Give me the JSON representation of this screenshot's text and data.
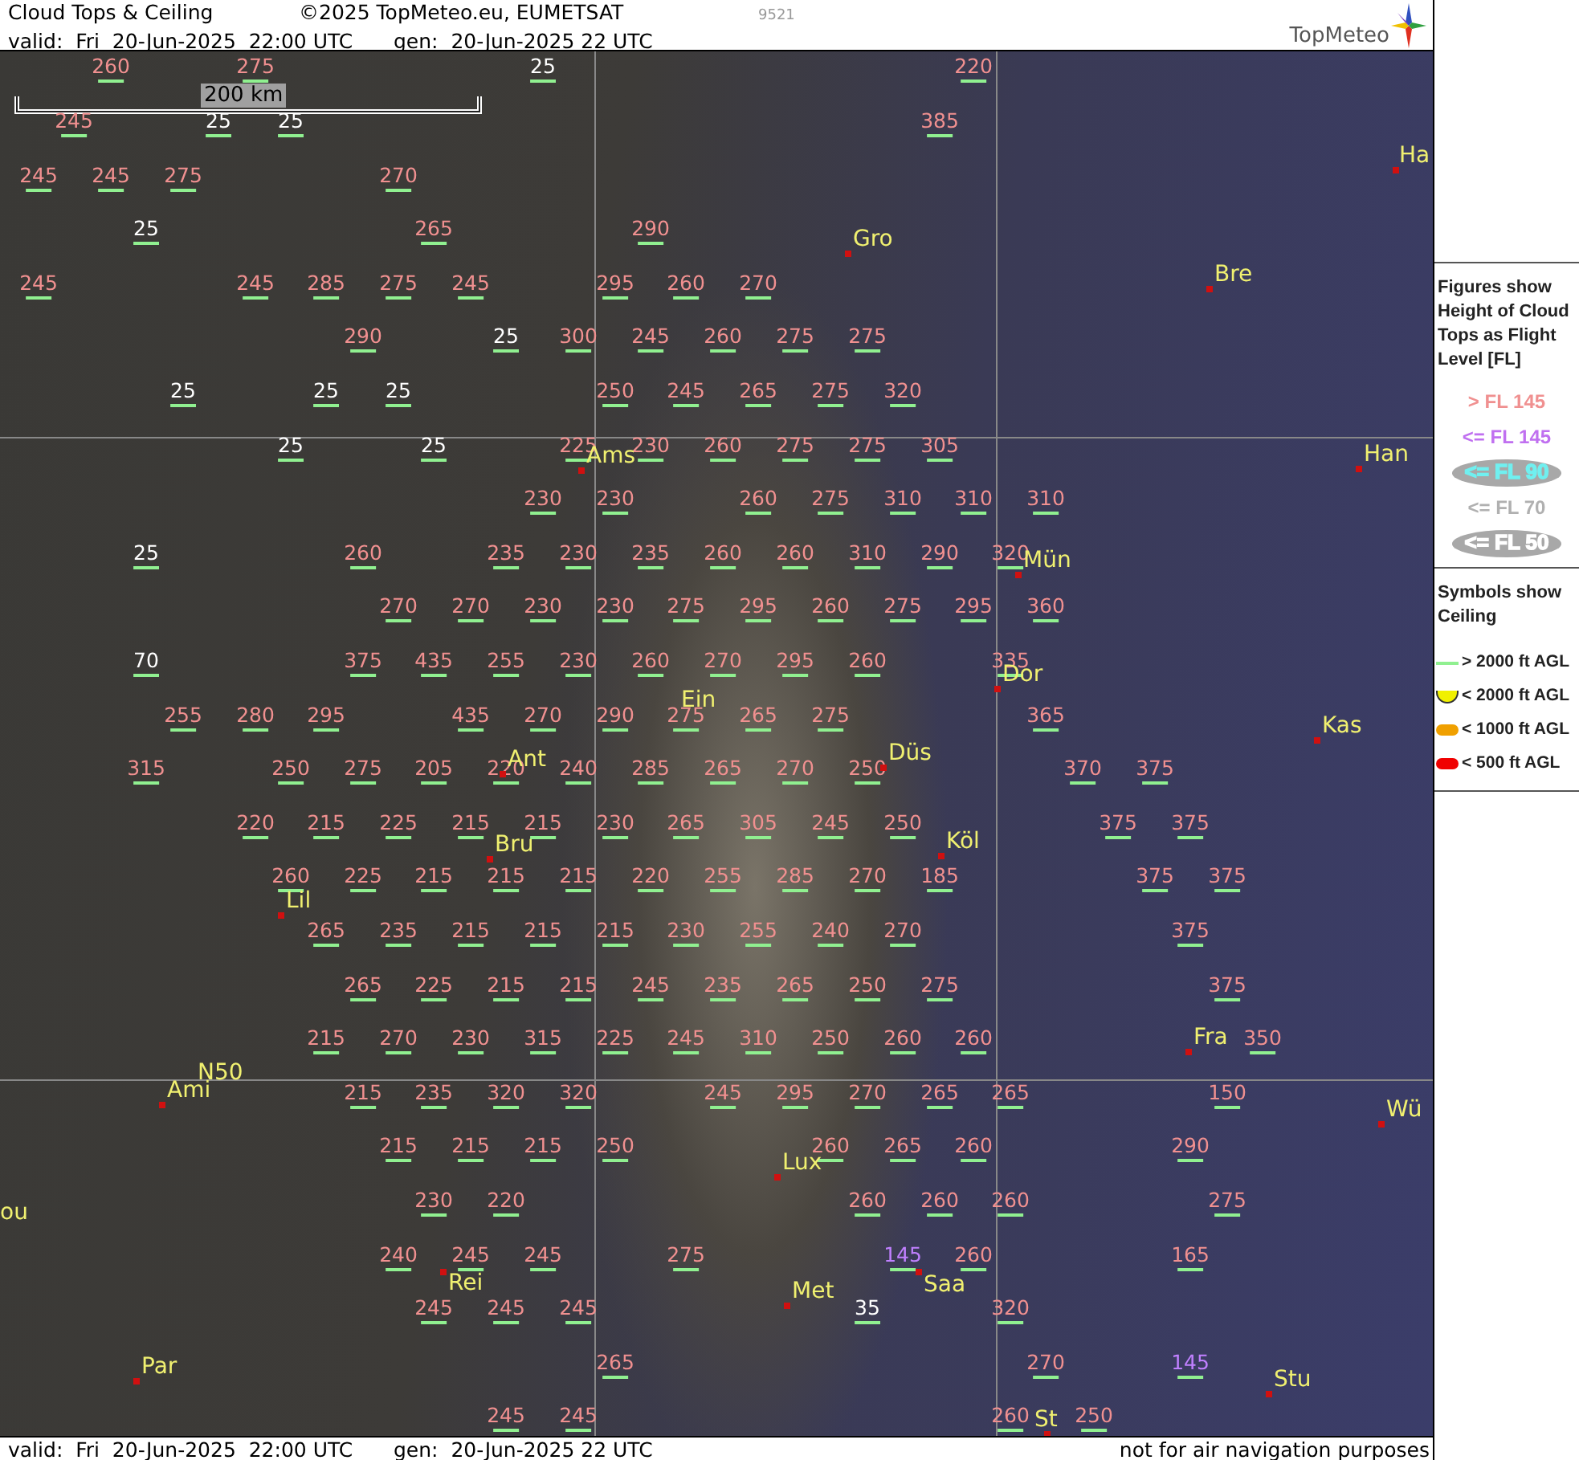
{
  "header": {
    "title": "Cloud Tops & Ceiling",
    "copyright": "©2025 TopMeteo.eu, EUMETSAT",
    "code": "9521",
    "valid": "valid:  Fri  20-Jun-2025  22:00 UTC",
    "generated": "gen:  20-Jun-2025 22 UTC",
    "logo": "TopMeteo"
  },
  "map": {
    "scale_bar": "200 km",
    "cloud_tops": [
      [
        {
          "value": "260",
          "color": "#f09090"
        },
        {
          "value": "275",
          "color": "#f09090"
        },
        {
          "value": "25",
          "color": "#ffffff"
        },
        {
          "value": "220",
          "color": "#f09090"
        }
      ],
      [
        {
          "value": "245",
          "color": "#f09090"
        },
        {
          "value": "25",
          "color": "#ffffff"
        },
        {
          "value": "25",
          "color": "#ffffff"
        },
        {
          "value": "385",
          "color": "#f09090"
        }
      ],
      [
        {
          "value": "245",
          "color": "#f09090"
        },
        {
          "value": "245",
          "color": "#f09090"
        },
        {
          "value": "275",
          "color": "#f09090"
        },
        {
          "value": "270",
          "color": "#f09090"
        }
      ],
      [
        {
          "value": "25",
          "color": "#ffffff"
        },
        {
          "value": "265",
          "color": "#f09090"
        },
        {
          "value": "290",
          "color": "#f09090"
        }
      ],
      [
        {
          "value": "245",
          "color": "#f09090"
        },
        {
          "value": "245",
          "color": "#f09090"
        },
        {
          "value": "285",
          "color": "#f09090"
        },
        {
          "value": "275",
          "color": "#f09090"
        },
        {
          "value": "245",
          "color": "#f09090"
        },
        {
          "value": "295",
          "color": "#f09090"
        },
        {
          "value": "260",
          "color": "#f09090"
        },
        {
          "value": "270",
          "color": "#f09090"
        }
      ],
      [
        {
          "value": "290",
          "color": "#f09090"
        },
        {
          "value": "25",
          "color": "#ffffff"
        },
        {
          "value": "300",
          "color": "#f09090"
        },
        {
          "value": "245",
          "color": "#f09090"
        },
        {
          "value": "260",
          "color": "#f09090"
        },
        {
          "value": "275",
          "color": "#f09090"
        },
        {
          "value": "275",
          "color": "#f09090"
        }
      ],
      [
        {
          "value": "25",
          "color": "#ffffff"
        },
        {
          "value": "25",
          "color": "#ffffff"
        },
        {
          "value": "25",
          "color": "#ffffff"
        },
        {
          "value": "250",
          "color": "#f09090"
        },
        {
          "value": "245",
          "color": "#f09090"
        },
        {
          "value": "265",
          "color": "#f09090"
        },
        {
          "value": "275",
          "color": "#f09090"
        },
        {
          "value": "320",
          "color": "#f09090"
        }
      ],
      [
        {
          "value": "25",
          "color": "#ffffff"
        },
        {
          "value": "25",
          "color": "#ffffff"
        },
        {
          "value": "225",
          "color": "#f09090"
        },
        {
          "value": "230",
          "color": "#f09090"
        },
        {
          "value": "260",
          "color": "#f09090"
        },
        {
          "value": "275",
          "color": "#f09090"
        },
        {
          "value": "275",
          "color": "#f09090"
        },
        {
          "value": "305",
          "color": "#f09090"
        }
      ],
      [
        {
          "value": "230",
          "color": "#f09090"
        },
        {
          "value": "230",
          "color": "#f09090"
        },
        {
          "value": "260",
          "color": "#f09090"
        },
        {
          "value": "275",
          "color": "#f09090"
        },
        {
          "value": "310",
          "color": "#f09090"
        },
        {
          "value": "310",
          "color": "#f09090"
        },
        {
          "value": "310",
          "color": "#f09090"
        }
      ],
      [
        {
          "value": "25",
          "color": "#ffffff"
        },
        {
          "value": "260",
          "color": "#f09090"
        },
        {
          "value": "235",
          "color": "#f09090"
        },
        {
          "value": "230",
          "color": "#f09090"
        },
        {
          "value": "235",
          "color": "#f09090"
        },
        {
          "value": "260",
          "color": "#f09090"
        },
        {
          "value": "260",
          "color": "#f09090"
        },
        {
          "value": "310",
          "color": "#f09090"
        },
        {
          "value": "290",
          "color": "#f09090"
        },
        {
          "value": "320",
          "color": "#f09090"
        }
      ],
      [
        {
          "value": "270",
          "color": "#f09090"
        },
        {
          "value": "270",
          "color": "#f09090"
        },
        {
          "value": "230",
          "color": "#f09090"
        },
        {
          "value": "230",
          "color": "#f09090"
        },
        {
          "value": "275",
          "color": "#f09090"
        },
        {
          "value": "295",
          "color": "#f09090"
        },
        {
          "value": "260",
          "color": "#f09090"
        },
        {
          "value": "275",
          "color": "#f09090"
        },
        {
          "value": "295",
          "color": "#f09090"
        },
        {
          "value": "360",
          "color": "#f09090"
        }
      ],
      [
        {
          "value": "70",
          "color": "#ffffff"
        },
        {
          "value": "375",
          "color": "#f09090"
        },
        {
          "value": "435",
          "color": "#f09090"
        },
        {
          "value": "255",
          "color": "#f09090"
        },
        {
          "value": "230",
          "color": "#f09090"
        },
        {
          "value": "260",
          "color": "#f09090"
        },
        {
          "value": "270",
          "color": "#f09090"
        },
        {
          "value": "295",
          "color": "#f09090"
        },
        {
          "value": "260",
          "color": "#f09090"
        },
        {
          "value": "335",
          "color": "#f09090"
        }
      ],
      [
        {
          "value": "255",
          "color": "#f09090"
        },
        {
          "value": "280",
          "color": "#f09090"
        },
        {
          "value": "295",
          "color": "#f09090"
        },
        {
          "value": "435",
          "color": "#f09090"
        },
        {
          "value": "270",
          "color": "#f09090"
        },
        {
          "value": "290",
          "color": "#f09090"
        },
        {
          "value": "275",
          "color": "#f09090"
        },
        {
          "value": "265",
          "color": "#f09090"
        },
        {
          "value": "275",
          "color": "#f09090"
        },
        {
          "value": "365",
          "color": "#f09090"
        }
      ],
      [
        {
          "value": "315",
          "color": "#f09090"
        },
        {
          "value": "250",
          "color": "#f09090"
        },
        {
          "value": "275",
          "color": "#f09090"
        },
        {
          "value": "205",
          "color": "#f09090"
        },
        {
          "value": "220",
          "color": "#f09090"
        },
        {
          "value": "240",
          "color": "#f09090"
        },
        {
          "value": "285",
          "color": "#f09090"
        },
        {
          "value": "265",
          "color": "#f09090"
        },
        {
          "value": "270",
          "color": "#f09090"
        },
        {
          "value": "250",
          "color": "#f09090"
        },
        {
          "value": "370",
          "color": "#f09090"
        },
        {
          "value": "375",
          "color": "#f09090"
        }
      ],
      [
        {
          "value": "220",
          "color": "#f09090"
        },
        {
          "value": "215",
          "color": "#f09090"
        },
        {
          "value": "225",
          "color": "#f09090"
        },
        {
          "value": "215",
          "color": "#f09090"
        },
        {
          "value": "215",
          "color": "#f09090"
        },
        {
          "value": "230",
          "color": "#f09090"
        },
        {
          "value": "265",
          "color": "#f09090"
        },
        {
          "value": "305",
          "color": "#f09090"
        },
        {
          "value": "245",
          "color": "#f09090"
        },
        {
          "value": "250",
          "color": "#f09090"
        },
        {
          "value": "375",
          "color": "#f09090"
        },
        {
          "value": "375",
          "color": "#f09090"
        }
      ],
      [
        {
          "value": "260",
          "color": "#f09090"
        },
        {
          "value": "225",
          "color": "#f09090"
        },
        {
          "value": "215",
          "color": "#f09090"
        },
        {
          "value": "215",
          "color": "#f09090"
        },
        {
          "value": "215",
          "color": "#f09090"
        },
        {
          "value": "220",
          "color": "#f09090"
        },
        {
          "value": "255",
          "color": "#f09090"
        },
        {
          "value": "285",
          "color": "#f09090"
        },
        {
          "value": "270",
          "color": "#f09090"
        },
        {
          "value": "185",
          "color": "#f09090"
        },
        {
          "value": "375",
          "color": "#f09090"
        },
        {
          "value": "375",
          "color": "#f09090"
        }
      ],
      [
        {
          "value": "265",
          "color": "#f09090"
        },
        {
          "value": "235",
          "color": "#f09090"
        },
        {
          "value": "215",
          "color": "#f09090"
        },
        {
          "value": "215",
          "color": "#f09090"
        },
        {
          "value": "215",
          "color": "#f09090"
        },
        {
          "value": "230",
          "color": "#f09090"
        },
        {
          "value": "255",
          "color": "#f09090"
        },
        {
          "value": "240",
          "color": "#f09090"
        },
        {
          "value": "270",
          "color": "#f09090"
        },
        {
          "value": "375",
          "color": "#f09090"
        }
      ],
      [
        {
          "value": "265",
          "color": "#f09090"
        },
        {
          "value": "225",
          "color": "#f09090"
        },
        {
          "value": "215",
          "color": "#f09090"
        },
        {
          "value": "215",
          "color": "#f09090"
        },
        {
          "value": "245",
          "color": "#f09090"
        },
        {
          "value": "235",
          "color": "#f09090"
        },
        {
          "value": "265",
          "color": "#f09090"
        },
        {
          "value": "250",
          "color": "#f09090"
        },
        {
          "value": "275",
          "color": "#f09090"
        },
        {
          "value": "375",
          "color": "#f09090"
        }
      ],
      [
        {
          "value": "215",
          "color": "#f09090"
        },
        {
          "value": "270",
          "color": "#f09090"
        },
        {
          "value": "230",
          "color": "#f09090"
        },
        {
          "value": "315",
          "color": "#f09090"
        },
        {
          "value": "225",
          "color": "#f09090"
        },
        {
          "value": "245",
          "color": "#f09090"
        },
        {
          "value": "310",
          "color": "#f09090"
        },
        {
          "value": "250",
          "color": "#f09090"
        },
        {
          "value": "260",
          "color": "#f09090"
        },
        {
          "value": "260",
          "color": "#f09090"
        },
        {
          "value": "350",
          "color": "#f09090"
        }
      ],
      [
        {
          "value": "215",
          "color": "#f09090"
        },
        {
          "value": "235",
          "color": "#f09090"
        },
        {
          "value": "320",
          "color": "#f09090"
        },
        {
          "value": "320",
          "color": "#f09090"
        },
        {
          "value": "245",
          "color": "#f09090"
        },
        {
          "value": "295",
          "color": "#f09090"
        },
        {
          "value": "270",
          "color": "#f09090"
        },
        {
          "value": "265",
          "color": "#f09090"
        },
        {
          "value": "265",
          "color": "#f09090"
        },
        {
          "value": "150",
          "color": "#f09090"
        }
      ],
      [
        {
          "value": "215",
          "color": "#f09090"
        },
        {
          "value": "215",
          "color": "#f09090"
        },
        {
          "value": "215",
          "color": "#f09090"
        },
        {
          "value": "250",
          "color": "#f09090"
        },
        {
          "value": "260",
          "color": "#f09090"
        },
        {
          "value": "265",
          "color": "#f09090"
        },
        {
          "value": "260",
          "color": "#f09090"
        },
        {
          "value": "290",
          "color": "#f09090"
        }
      ],
      [
        {
          "value": "230",
          "color": "#f09090"
        },
        {
          "value": "220",
          "color": "#f09090"
        },
        {
          "value": "260",
          "color": "#f09090"
        },
        {
          "value": "260",
          "color": "#f09090"
        },
        {
          "value": "260",
          "color": "#f09090"
        },
        {
          "value": "275",
          "color": "#f09090"
        }
      ],
      [
        {
          "value": "240",
          "color": "#f09090"
        },
        {
          "value": "245",
          "color": "#f09090"
        },
        {
          "value": "245",
          "color": "#f09090"
        },
        {
          "value": "275",
          "color": "#f09090"
        },
        {
          "value": "145",
          "color": "#c080ff"
        },
        {
          "value": "260",
          "color": "#f09090"
        },
        {
          "value": "165",
          "color": "#f09090"
        }
      ],
      [
        {
          "value": "245",
          "color": "#f09090"
        },
        {
          "value": "245",
          "color": "#f09090"
        },
        {
          "value": "245",
          "color": "#f09090"
        },
        {
          "value": "35",
          "color": "#ffffff"
        },
        {
          "value": "320",
          "color": "#f09090"
        }
      ],
      [
        {
          "value": "265",
          "color": "#f09090"
        },
        {
          "value": "270",
          "color": "#f09090"
        },
        {
          "value": "145",
          "color": "#c080ff"
        }
      ],
      [
        {
          "value": "245",
          "color": "#f09090"
        },
        {
          "value": "245",
          "color": "#f09090"
        },
        {
          "value": "260",
          "color": "#f09090"
        },
        {
          "value": "250",
          "color": "#f09090"
        }
      ]
    ],
    "cities": [
      {
        "name": "Ha",
        "dot": true
      },
      {
        "name": "Gro",
        "dot": true
      },
      {
        "name": "Bre",
        "dot": true
      },
      {
        "name": "Ams",
        "dot": true
      },
      {
        "name": "Han",
        "dot": true
      },
      {
        "name": "Mün",
        "dot": true
      },
      {
        "name": "Dor",
        "dot": true
      },
      {
        "name": "Ein",
        "dot": false
      },
      {
        "name": "Kas",
        "dot": true
      },
      {
        "name": "Ant",
        "dot": true
      },
      {
        "name": "Düs",
        "dot": true
      },
      {
        "name": "Köl",
        "dot": true
      },
      {
        "name": "Bru",
        "dot": true
      },
      {
        "name": "Lil",
        "dot": true
      },
      {
        "name": "Fra",
        "dot": true
      },
      {
        "name": "N50",
        "dot": false
      },
      {
        "name": "Ami",
        "dot": true
      },
      {
        "name": "Wü",
        "dot": true
      },
      {
        "name": "Lux",
        "dot": true
      },
      {
        "name": "ou",
        "dot": false
      },
      {
        "name": "Rei",
        "dot": true
      },
      {
        "name": "Met",
        "dot": true
      },
      {
        "name": "Saa",
        "dot": true
      },
      {
        "name": "Par",
        "dot": true
      },
      {
        "name": "Stu",
        "dot": true
      },
      {
        "name": "St",
        "dot": true
      }
    ]
  },
  "legend": {
    "tops_title": "Figures show Height of Cloud Tops as Flight Level  [FL]",
    "tops": [
      {
        "label": "> FL 145",
        "color": "#f09090",
        "shaded": false
      },
      {
        "label": "<= FL 145",
        "color": "#c070f0",
        "shaded": false
      },
      {
        "label": "<= FL 90",
        "color": "#70f0f0",
        "shaded": true
      },
      {
        "label": "<= FL 70",
        "color": "#b0b0b0",
        "shaded": false
      },
      {
        "label": "<= FL 50",
        "color": "#ffffff",
        "shaded": true
      }
    ],
    "ceiling_title": "Symbols show Ceiling",
    "ceiling": [
      {
        "label": "> 2000 ft AGL",
        "kind": "line",
        "color": "#90f090"
      },
      {
        "label": "< 2000 ft AGL",
        "kind": "cup",
        "color": "#f0f000"
      },
      {
        "label": "< 1000 ft AGL",
        "kind": "pill",
        "color": "#f0a000"
      },
      {
        "label": "< 500 ft AGL",
        "kind": "pill",
        "color": "#f00000"
      }
    ]
  },
  "footer": {
    "valid": "valid:  Fri  20-Jun-2025  22:00 UTC",
    "generated": "gen:  20-Jun-2025 22 UTC",
    "disclaimer": "not for air navigation purposes"
  }
}
